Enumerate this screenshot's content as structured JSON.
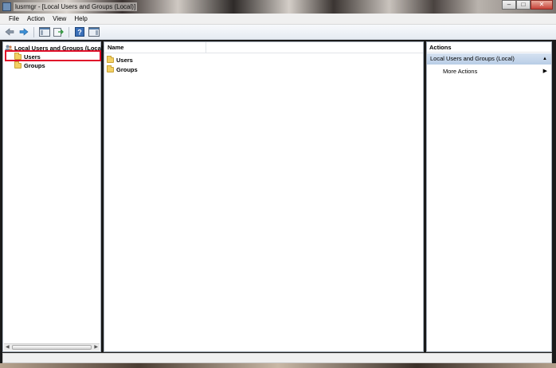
{
  "window": {
    "title": "lusrmgr - [Local Users and Groups (Local)]",
    "buttons": {
      "minimize": "–",
      "maximize": "□",
      "close": "✕"
    }
  },
  "menu": [
    "File",
    "Action",
    "View",
    "Help"
  ],
  "toolbar": {
    "icons": [
      "back-icon",
      "forward-icon",
      "show-hide-tree-icon",
      "export-list-icon",
      "help-icon",
      "show-hide-action-pane-icon"
    ]
  },
  "tree": {
    "root": "Local Users and Groups (Local)",
    "items": [
      {
        "label": "Users",
        "selected": true
      },
      {
        "label": "Groups",
        "selected": false
      }
    ]
  },
  "list": {
    "columns": [
      "Name"
    ],
    "rows": [
      {
        "name": "Users"
      },
      {
        "name": "Groups"
      }
    ]
  },
  "actions": {
    "header": "Actions",
    "section": "Local Users and Groups (Local)",
    "links": [
      "More Actions"
    ]
  },
  "colors": {
    "highlight_box": "#e0102a",
    "actions_section_bg": "#c6d8ee",
    "folder": "#f2cf63"
  }
}
